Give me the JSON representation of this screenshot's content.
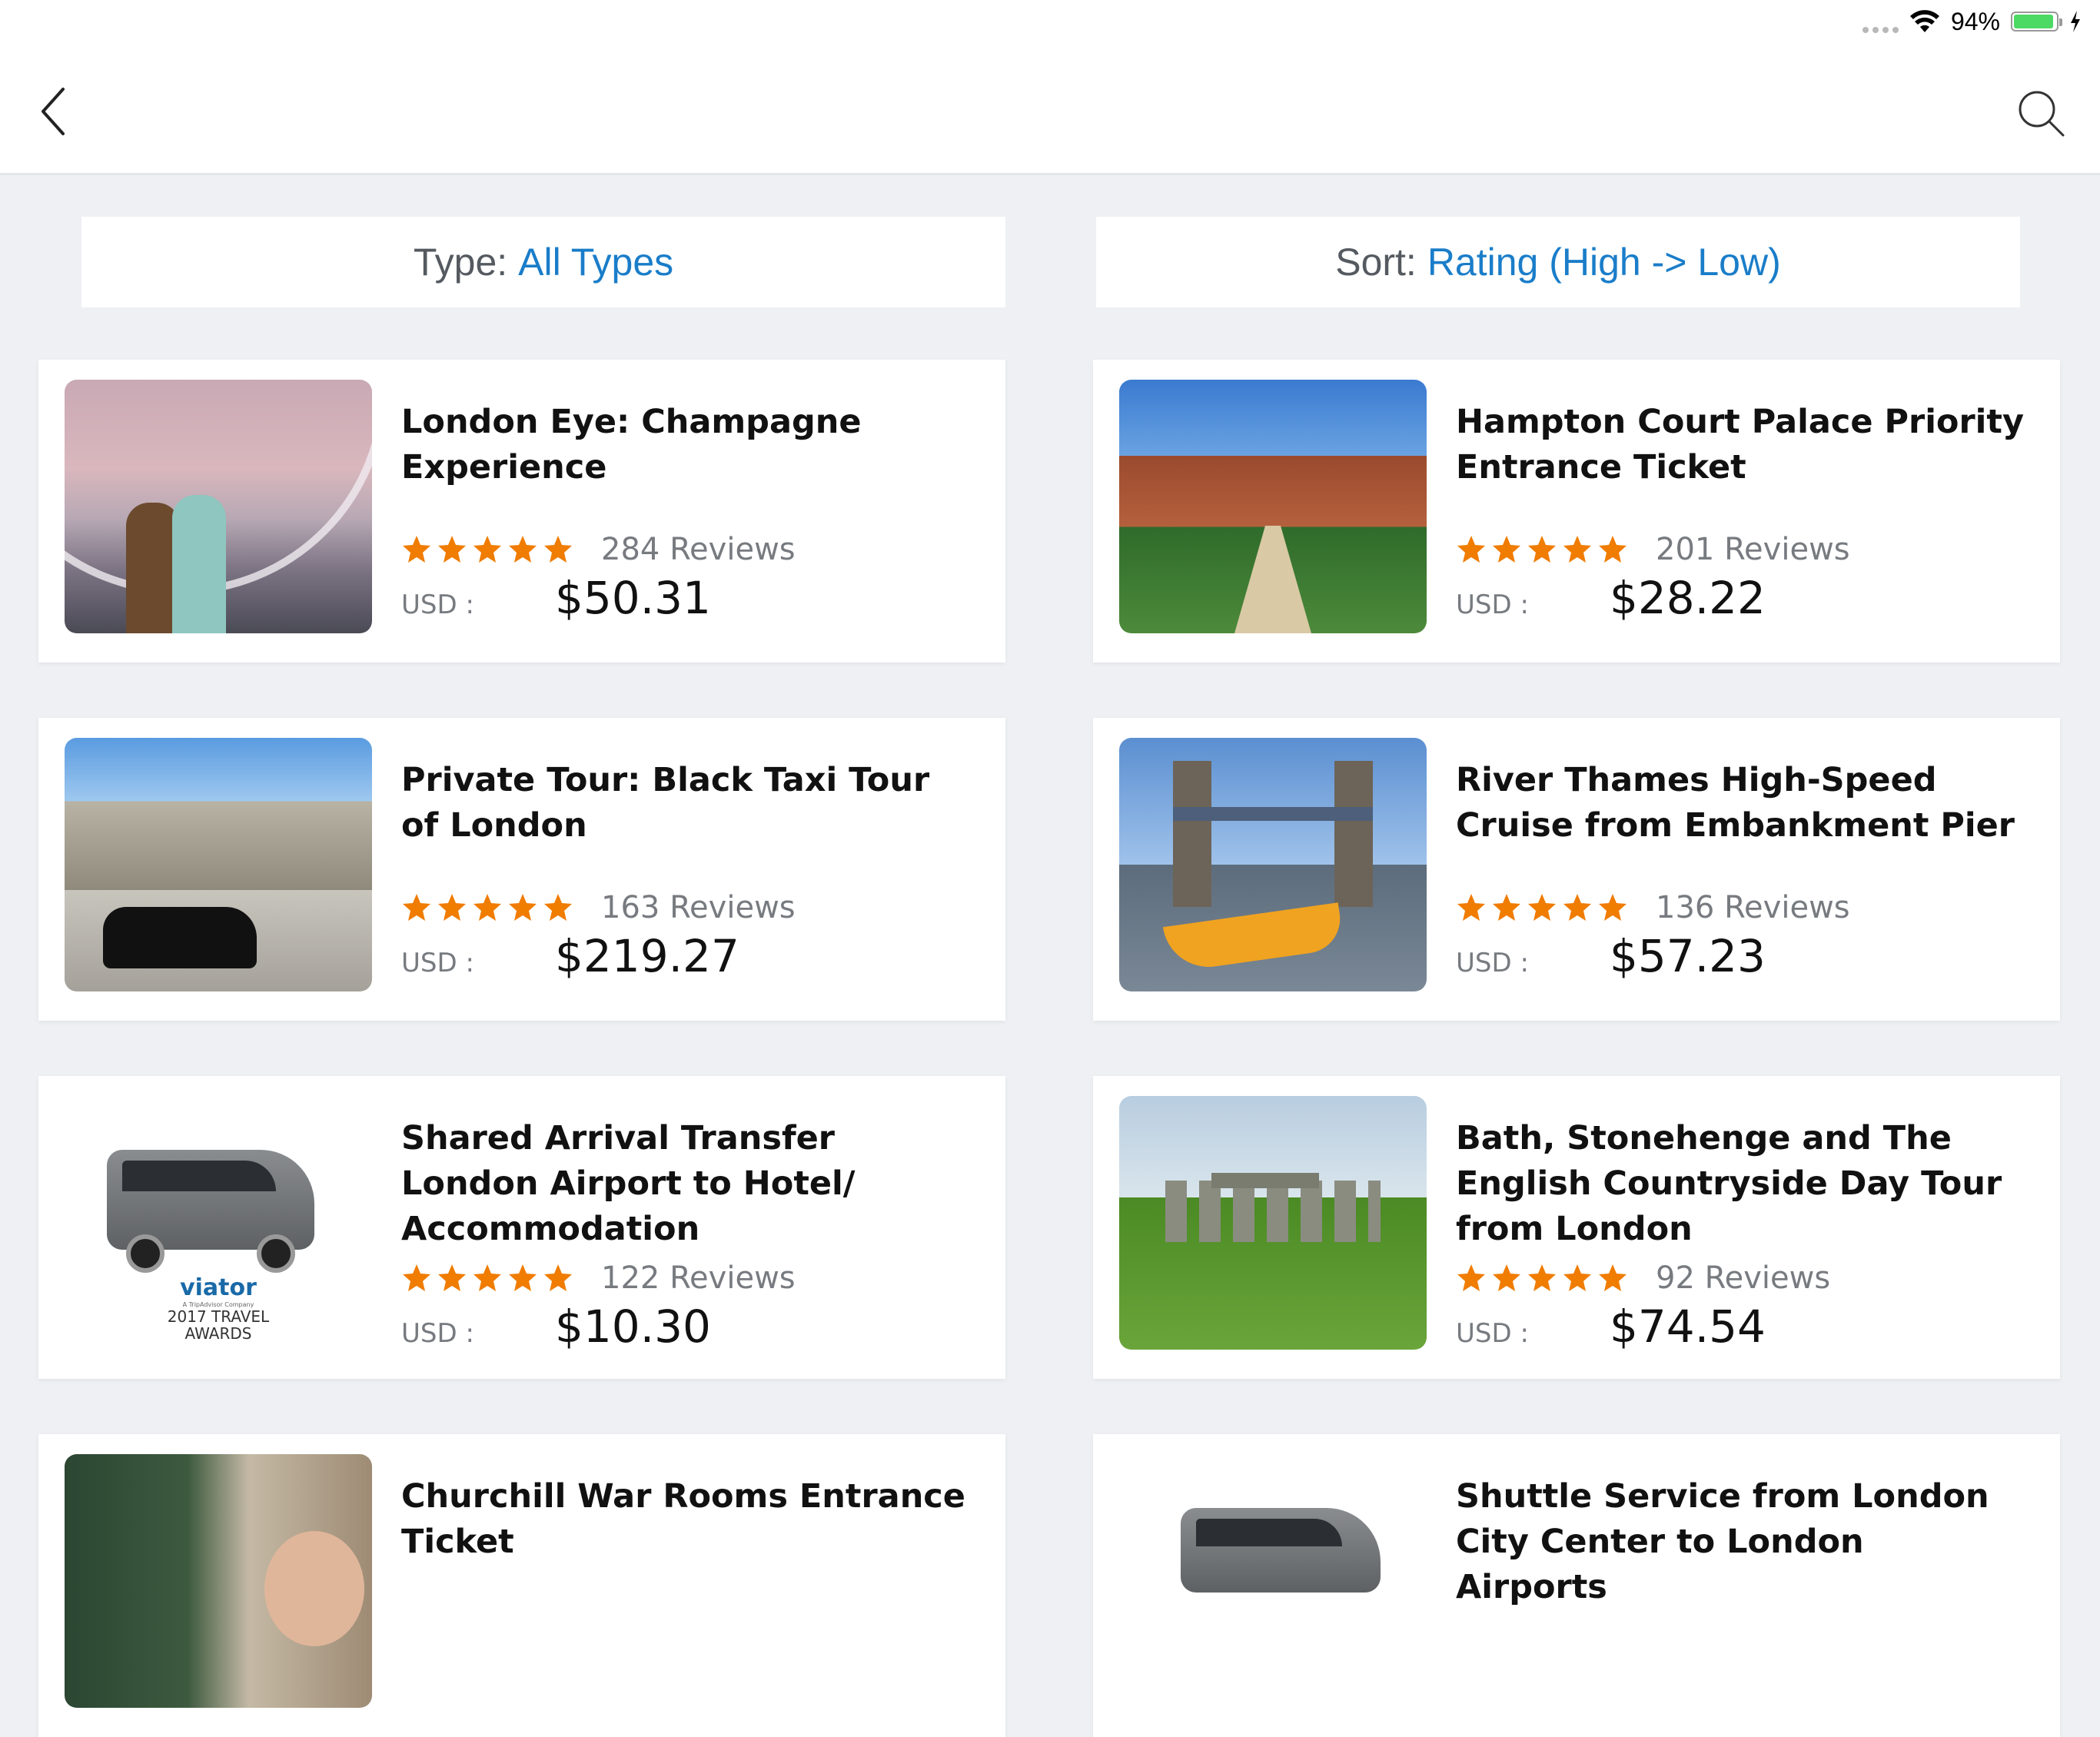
{
  "status_bar": {
    "battery_percent": "94%",
    "battery_level": 0.94
  },
  "nav": {
    "back_icon": "chevron-left-icon",
    "search_icon": "search-icon"
  },
  "filters": {
    "type_label": "Type:",
    "type_value": "All Types",
    "sort_label": "Sort:",
    "sort_value": "Rating (High -> Low)"
  },
  "colors": {
    "accent": "#1a7dc9",
    "star": "#f07c00"
  },
  "currency_label": "USD :",
  "listings": [
    {
      "title": "London Eye: Champagne Experience",
      "rating": 5,
      "reviews": "284 Reviews",
      "price": "$50.31",
      "image": "london-eye-photo"
    },
    {
      "title": "Hampton Court Palace Priority Entrance Ticket",
      "rating": 5,
      "reviews": "201 Reviews",
      "price": "$28.22",
      "image": "hampton-court-photo"
    },
    {
      "title": "Private Tour: Black Taxi Tour of London",
      "rating": 5,
      "reviews": "163 Reviews",
      "price": "$219.27",
      "image": "black-taxi-photo"
    },
    {
      "title": "River Thames High-Speed Cruise from Embankment Pier",
      "rating": 5,
      "reviews": "136 Reviews",
      "price": "$57.23",
      "image": "tower-bridge-boat-photo"
    },
    {
      "title": "Shared Arrival Transfer London Airport to Hotel/ Accommodation",
      "rating": 5,
      "reviews": "122 Reviews",
      "price": "$10.30",
      "image": "van-viator-award-photo",
      "image_text": {
        "brand": "viator",
        "sub": "A TripAdvisor Company",
        "award_line1": "2017 TRAVEL",
        "award_line2": "AWARDS"
      }
    },
    {
      "title": "Bath, Stonehenge and The English Countryside Day Tour from London",
      "rating": 5,
      "reviews": "92 Reviews",
      "price": "$74.54",
      "image": "stonehenge-photo"
    },
    {
      "title": "Churchill War Rooms Entrance Ticket",
      "image": "war-rooms-photo"
    },
    {
      "title": "Shuttle Service from London City Center to London Airports",
      "image": "shuttle-van-photo"
    }
  ]
}
